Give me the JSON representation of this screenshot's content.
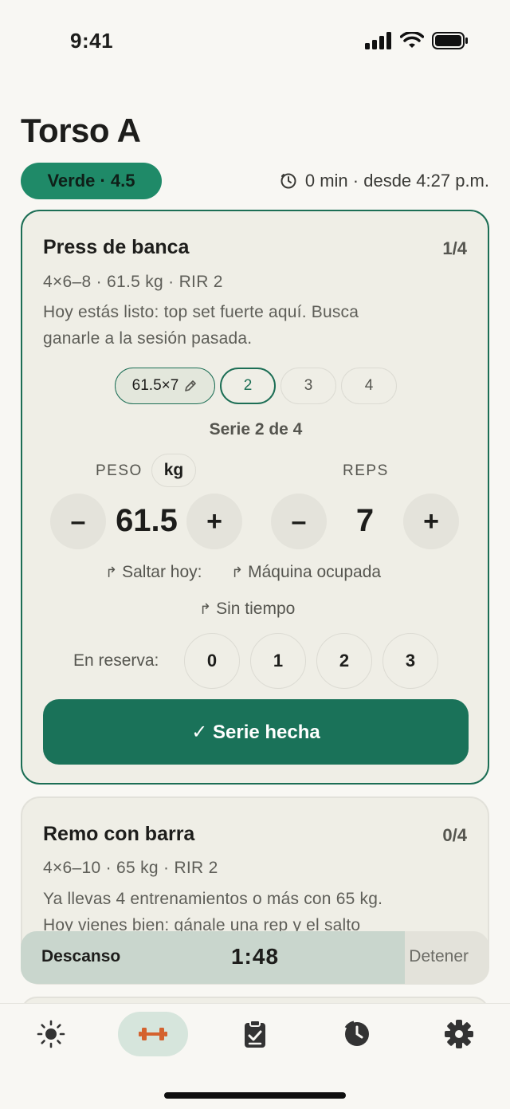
{
  "status": {
    "time": "9:41"
  },
  "header": {
    "title": "Torso A",
    "badge": "Verde · 4.5",
    "session_meta": "0 min · desde 4:27 p.m."
  },
  "exercise1": {
    "name": "Press de banca",
    "count": "1/4",
    "meta": "4×6–8 · 61.5 kg · RIR 2",
    "note_line1": "Hoy estás listo: top set fuerte aquí. Busca",
    "note_line2": "ganarle a la sesión pasada.",
    "sets": {
      "done": "61.5×7",
      "s2": "2",
      "s3": "3",
      "s4": "4"
    },
    "serie_label": "Serie 2 de 4",
    "weight_caption": "PESO",
    "unit": "kg",
    "reps_caption": "REPS",
    "weight_value": "61.5",
    "reps_value": "7",
    "minus": "–",
    "plus": "+",
    "skip_today": "Saltar hoy:",
    "machine_busy": "Máquina ocupada",
    "no_time": "Sin tiempo",
    "reserve_label": "En reserva:",
    "rir_options": [
      "0",
      "1",
      "2",
      "3"
    ],
    "done_button": "✓ Serie hecha"
  },
  "exercise2": {
    "name": "Remo con barra",
    "count": "0/4",
    "meta": "4×6–10 · 65 kg · RIR 2",
    "note_line1": "Ya llevas 4 entrenamientos o más con 65 kg.",
    "note_line2": "Hoy vienes bien: gánale una rep y el salto"
  },
  "rest": {
    "label": "Descanso",
    "time": "1:48",
    "stop": "Detener",
    "progress": 0.82
  },
  "colors": {
    "accent": "#1a7259",
    "badge": "#1f8a68",
    "background": "#f8f7f3",
    "card": "#efeee6"
  },
  "tabs": [
    "sun-icon",
    "dumbbell-icon",
    "clipboard-check-icon",
    "history-clock-icon",
    "gear-icon"
  ]
}
